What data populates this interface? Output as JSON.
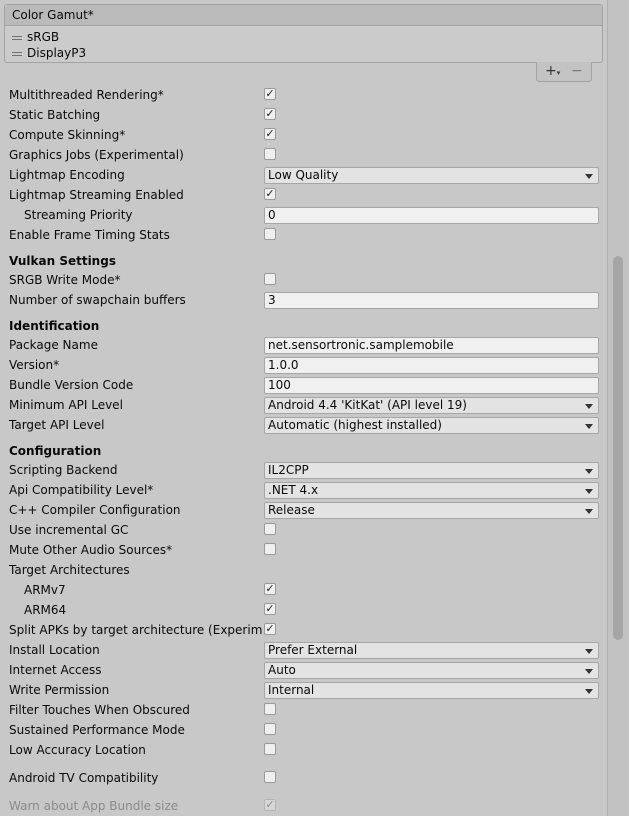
{
  "color_gamut": {
    "title": "Color Gamut*",
    "items": [
      "sRGB",
      "DisplayP3"
    ],
    "add_label": "+",
    "add_sub": "▾",
    "remove_label": "−"
  },
  "checkmark": "✓",
  "rendering": {
    "multithreaded_rendering": {
      "label": "Multithreaded Rendering*",
      "checked": true
    },
    "static_batching": {
      "label": "Static Batching",
      "checked": true
    },
    "compute_skinning": {
      "label": "Compute Skinning*",
      "checked": true
    },
    "graphics_jobs": {
      "label": "Graphics Jobs (Experimental)",
      "checked": false
    },
    "lightmap_encoding": {
      "label": "Lightmap Encoding",
      "value": "Low Quality"
    },
    "lightmap_streaming": {
      "label": "Lightmap Streaming Enabled",
      "checked": true
    },
    "streaming_priority": {
      "label": "Streaming Priority",
      "value": "0"
    },
    "frame_timing_stats": {
      "label": "Enable Frame Timing Stats",
      "checked": false
    }
  },
  "vulkan": {
    "heading": "Vulkan Settings",
    "srgb_write_mode": {
      "label": "SRGB Write Mode*",
      "checked": false
    },
    "swapchain_buffers": {
      "label": "Number of swapchain buffers",
      "value": "3"
    }
  },
  "identification": {
    "heading": "Identification",
    "package_name": {
      "label": "Package Name",
      "value": "net.sensortronic.samplemobile"
    },
    "version": {
      "label": "Version*",
      "value": "1.0.0"
    },
    "bundle_version_code": {
      "label": "Bundle Version Code",
      "value": "100"
    },
    "min_api_level": {
      "label": "Minimum API Level",
      "value": "Android 4.4 'KitKat' (API level 19)"
    },
    "target_api_level": {
      "label": "Target API Level",
      "value": "Automatic (highest installed)"
    }
  },
  "configuration": {
    "heading": "Configuration",
    "scripting_backend": {
      "label": "Scripting Backend",
      "value": "IL2CPP"
    },
    "api_compatibility": {
      "label": "Api Compatibility Level*",
      "value": ".NET 4.x"
    },
    "cpp_compiler": {
      "label": "C++ Compiler Configuration",
      "value": "Release"
    },
    "incremental_gc": {
      "label": "Use incremental GC",
      "checked": false
    },
    "mute_audio": {
      "label": "Mute Other Audio Sources*",
      "checked": false
    },
    "target_architectures": {
      "label": "Target Architectures"
    },
    "armv7": {
      "label": "ARMv7",
      "checked": true
    },
    "arm64": {
      "label": "ARM64",
      "checked": true
    },
    "split_apks": {
      "label": "Split APKs by target architecture (Experimental)",
      "checked": true
    },
    "install_location": {
      "label": "Install Location",
      "value": "Prefer External"
    },
    "internet_access": {
      "label": "Internet Access",
      "value": "Auto"
    },
    "write_permission": {
      "label": "Write Permission",
      "value": "Internal"
    },
    "filter_touches": {
      "label": "Filter Touches When Obscured",
      "checked": false
    },
    "sustained_performance": {
      "label": "Sustained Performance Mode",
      "checked": false
    },
    "low_accuracy_location": {
      "label": "Low Accuracy Location",
      "checked": false
    },
    "android_tv": {
      "label": "Android TV Compatibility",
      "checked": false
    },
    "warn_bundle_size": {
      "label": "Warn about App Bundle size",
      "checked": true,
      "disabled": true
    }
  }
}
